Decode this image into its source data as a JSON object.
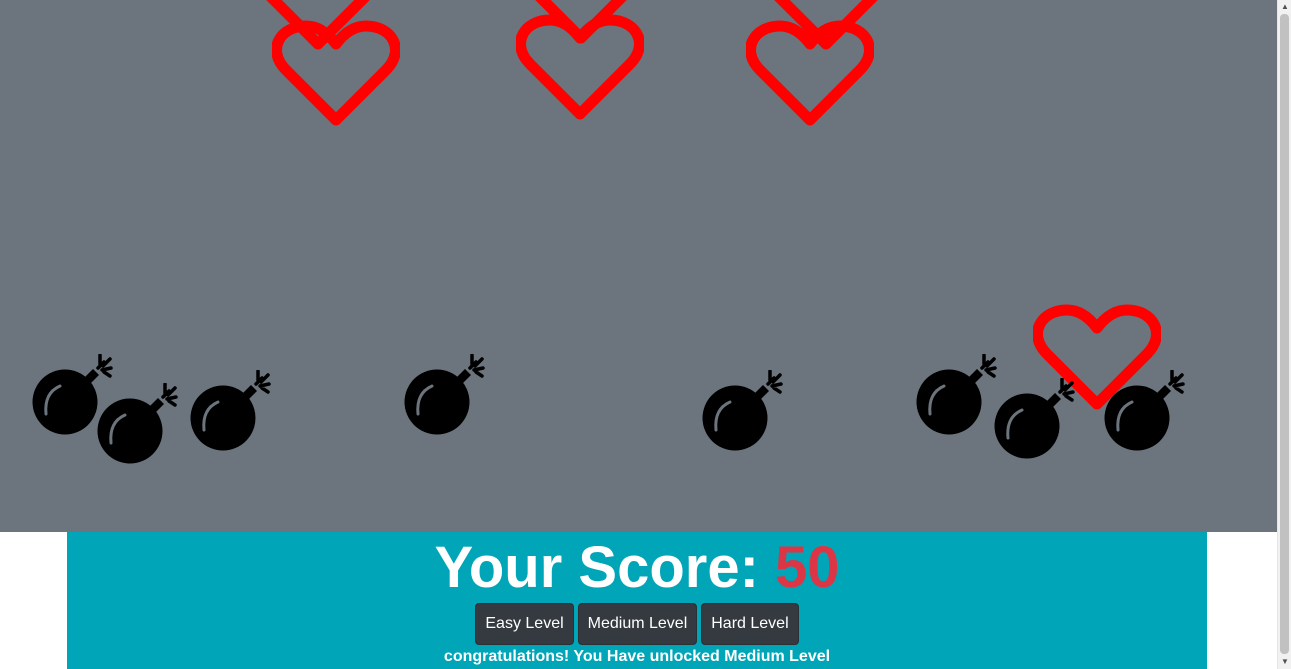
{
  "game": {
    "background_color": "#6c757d",
    "heart_color": "#ff0000",
    "bomb_color": "#000000",
    "heart_icon": "heart-outline-icon",
    "bomb_icon": "bomb-icon"
  },
  "score": {
    "label": "Your Score:",
    "value": "50",
    "value_color": "#dc3545",
    "panel_color": "#00a5b8"
  },
  "levels": {
    "easy_label": "Easy Level",
    "medium_label": "Medium Level",
    "hard_label": "Hard Level"
  },
  "message": "congratulations! You Have unlocked Medium Level"
}
